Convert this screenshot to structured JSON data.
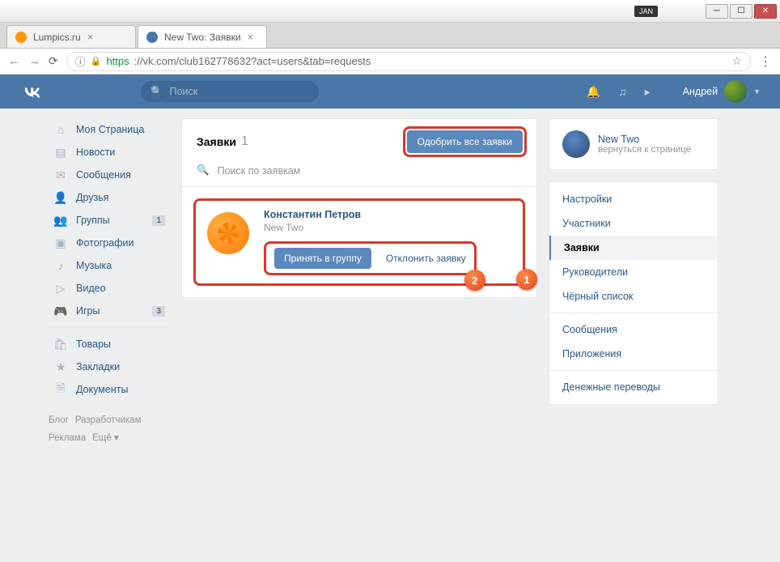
{
  "window": {
    "jan": "JAN"
  },
  "tabs": [
    {
      "title": "Lumpics.ru"
    },
    {
      "title": "New Two: Заявки"
    }
  ],
  "addr": {
    "https": "https",
    "url": "://vk.com/club162778632?act=users&tab=requests"
  },
  "header": {
    "search": "Поиск",
    "username": "Андрей"
  },
  "nav": {
    "items": [
      {
        "label": "Моя Страница"
      },
      {
        "label": "Новости"
      },
      {
        "label": "Сообщения"
      },
      {
        "label": "Друзья"
      },
      {
        "label": "Группы",
        "badge": "1"
      },
      {
        "label": "Фотографии"
      },
      {
        "label": "Музыка"
      },
      {
        "label": "Видео"
      },
      {
        "label": "Игры",
        "badge": "3"
      }
    ],
    "more": [
      {
        "label": "Товары"
      },
      {
        "label": "Закладки"
      },
      {
        "label": "Документы"
      }
    ],
    "footer": {
      "blog": "Блог",
      "dev": "Разработчикам",
      "ads": "Реклама",
      "more": "Ещё ▾"
    }
  },
  "main": {
    "title": "Заявки",
    "count": "1",
    "approve_all": "Одобрить все заявки",
    "search_placeholder": "Поиск по заявкам",
    "request": {
      "name": "Константин Петров",
      "group": "New Two",
      "accept": "Принять в группу",
      "decline": "Отклонить заявку"
    }
  },
  "annotations": {
    "n1": "1",
    "n2": "2"
  },
  "rightcol": {
    "group": {
      "name": "New Two",
      "return": "вернуться к странице"
    },
    "menu": [
      {
        "label": "Настройки"
      },
      {
        "label": "Участники"
      },
      {
        "label": "Заявки",
        "active": true
      },
      {
        "label": "Руководители"
      },
      {
        "label": "Чёрный список"
      },
      {
        "div": true
      },
      {
        "label": "Сообщения"
      },
      {
        "label": "Приложения"
      },
      {
        "div": true
      },
      {
        "label": "Денежные переводы"
      }
    ]
  }
}
